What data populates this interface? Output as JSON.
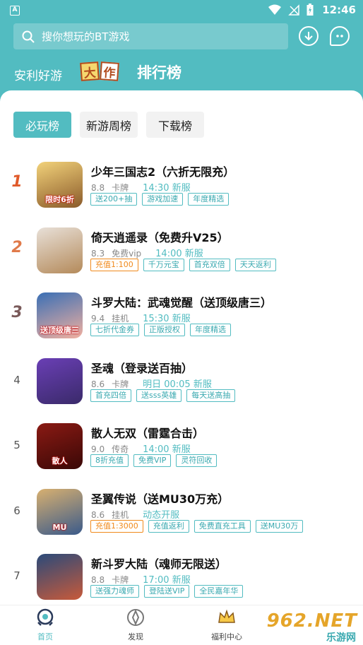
{
  "status_bar": {
    "time": "12:46"
  },
  "search": {
    "placeholder": "搜你想玩的BT游戏"
  },
  "nav": {
    "anli": "安利好游",
    "dazuo_chars": [
      "大",
      "作"
    ],
    "rank": "排行榜"
  },
  "tabs": [
    {
      "label": "必玩榜",
      "active": true
    },
    {
      "label": "新游周榜",
      "active": false
    },
    {
      "label": "下载榜",
      "active": false
    }
  ],
  "games": [
    {
      "rank": "1",
      "title": "少年三国志2（六折无限充）",
      "rating": "8.8",
      "category": "卡牌",
      "server": "14:30 新服",
      "icon_badge": "限时6折",
      "icon_colors": [
        "#f2d27a",
        "#8a5a2a"
      ],
      "tags": [
        {
          "text": "送200+抽",
          "color": "teal"
        },
        {
          "text": "游戏加速",
          "color": "teal"
        },
        {
          "text": "年度精选",
          "color": "teal"
        }
      ]
    },
    {
      "rank": "2",
      "title": "倚天逍遥录（免费升V25）",
      "rating": "8.3",
      "category": "免费vip",
      "server": "14:00 新服",
      "icon_badge": "",
      "icon_colors": [
        "#e8e0d8",
        "#b48a5a"
      ],
      "tags": [
        {
          "text": "充值1:100",
          "color": "orange"
        },
        {
          "text": "千万元宝",
          "color": "teal"
        },
        {
          "text": "首充双倍",
          "color": "teal"
        },
        {
          "text": "天天返利",
          "color": "teal"
        }
      ]
    },
    {
      "rank": "3",
      "title": "斗罗大陆：武魂觉醒（送顶级唐三）",
      "rating": "9.4",
      "category": "挂机",
      "server": "15:30 新服",
      "icon_badge": "送顶级唐三",
      "icon_colors": [
        "#3a6fb5",
        "#f1b0a0"
      ],
      "tags": [
        {
          "text": "七折代金券",
          "color": "teal"
        },
        {
          "text": "正版授权",
          "color": "teal"
        },
        {
          "text": "年度精选",
          "color": "teal"
        }
      ]
    },
    {
      "rank": "4",
      "title": "圣魂（登录送百抽）",
      "rating": "8.6",
      "category": "卡牌",
      "server": "明日 00:05 新服",
      "icon_badge": "",
      "icon_colors": [
        "#6a3fb5",
        "#3a2a6a"
      ],
      "tags": [
        {
          "text": "首充四倍",
          "color": "teal"
        },
        {
          "text": "送sss英雄",
          "color": "teal"
        },
        {
          "text": "每天送高抽",
          "color": "teal"
        }
      ]
    },
    {
      "rank": "5",
      "title": "散人无双（雷霆合击）",
      "rating": "9.0",
      "category": "传奇",
      "server": "14:00 新服",
      "icon_badge": "散人",
      "icon_colors": [
        "#8a1a14",
        "#3a0806"
      ],
      "tags": [
        {
          "text": "8折充值",
          "color": "teal"
        },
        {
          "text": "免费VIP",
          "color": "teal"
        },
        {
          "text": "灵符回收",
          "color": "teal"
        }
      ]
    },
    {
      "rank": "6",
      "title": "圣翼传说（送MU30万充）",
      "rating": "8.6",
      "category": "挂机",
      "server": "动态开服",
      "icon_badge": "MU",
      "icon_colors": [
        "#d8b070",
        "#3a5a8a"
      ],
      "tags": [
        {
          "text": "充值1:3000",
          "color": "orange"
        },
        {
          "text": "充值返利",
          "color": "teal"
        },
        {
          "text": "免费直充工具",
          "color": "teal"
        },
        {
          "text": "送MU30万",
          "color": "teal"
        }
      ]
    },
    {
      "rank": "7",
      "title": "新斗罗大陆（魂师无限送）",
      "rating": "8.8",
      "category": "卡牌",
      "server": "17:00 新服",
      "icon_badge": "",
      "icon_colors": [
        "#2a4a7a",
        "#c85a3a"
      ],
      "tags": [
        {
          "text": "送强力魂师",
          "color": "teal"
        },
        {
          "text": "登陆送VIP",
          "color": "teal"
        },
        {
          "text": "全民嘉年华",
          "color": "teal"
        }
      ]
    }
  ],
  "bottom_nav": [
    {
      "label": "首页",
      "active": true
    },
    {
      "label": "发现",
      "active": false
    },
    {
      "label": "福利中心",
      "active": false
    }
  ],
  "watermark": {
    "big": "962.NET",
    "small": "乐游网"
  },
  "colors": {
    "accent": "#52bcc1",
    "orange": "#f08a1c"
  }
}
